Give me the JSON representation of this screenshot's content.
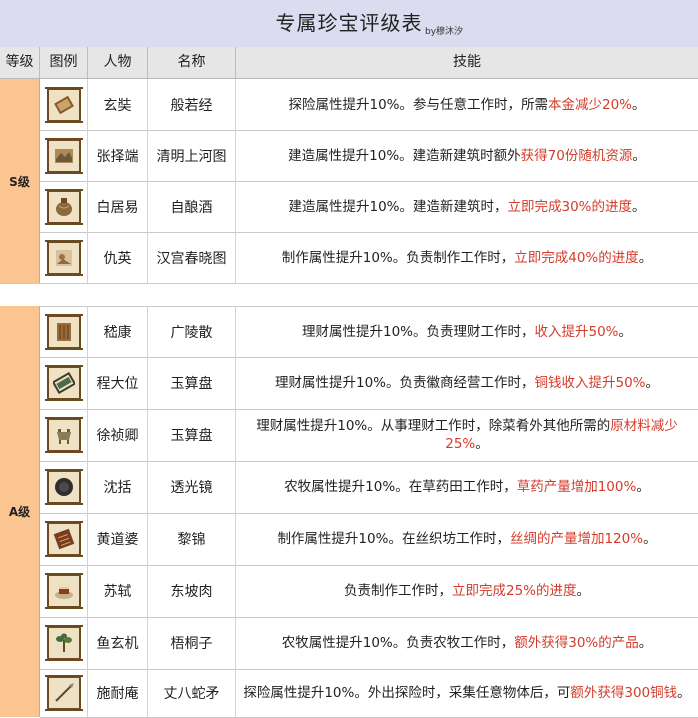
{
  "page": {
    "title": "专属珍宝评级表",
    "byline": "by穆沐汐"
  },
  "header": {
    "grade": "等级",
    "icon": "图例",
    "person": "人物",
    "name": "名称",
    "skill": "技能"
  },
  "sections": [
    {
      "grade": "S级",
      "rows": [
        {
          "icon": "scroll-book-icon",
          "person": "玄奘",
          "name": "般若经",
          "skill_plain": "探险属性提升10%。参与任意工作时，所需",
          "skill_hl": "本金减少20%",
          "skill_end": "。"
        },
        {
          "icon": "painting-scroll-icon",
          "person": "张择端",
          "name": "清明上河图",
          "skill_plain": "建造属性提升10%。建造新建筑时额外",
          "skill_hl": "获得70份随机资源",
          "skill_end": "。"
        },
        {
          "icon": "wine-jar-icon",
          "person": "白居易",
          "name": "自酿酒",
          "skill_plain": "建造属性提升10%。建造新建筑时，",
          "skill_hl": "立即完成30%的进度",
          "skill_end": "。"
        },
        {
          "icon": "spring-painting-icon",
          "person": "仇英",
          "name": "汉宫春晓图",
          "skill_plain": "制作属性提升10%。负责制作工作时，",
          "skill_hl": "立即完成40%的进度",
          "skill_end": "。"
        }
      ]
    },
    {
      "grade": "A级",
      "rows": [
        {
          "icon": "guqin-score-icon",
          "person": "嵇康",
          "name": "广陵散",
          "skill_plain": "理财属性提升10%。负责理财工作时，",
          "skill_hl": "收入提升50%",
          "skill_end": "。"
        },
        {
          "icon": "abacus-icon",
          "person": "程大位",
          "name": "玉算盘",
          "skill_plain": "理财属性提升10%。负责徽商经营工作时，",
          "skill_hl": "铜钱收入提升50%",
          "skill_end": "。"
        },
        {
          "icon": "cauldron-icon",
          "person": "徐祯卿",
          "name": "玉算盘",
          "skill_plain": "理财属性提升10%。从事理财工作时，除菜肴外其他所需的",
          "skill_hl": "原材料减少25%",
          "skill_end": "。"
        },
        {
          "icon": "lens-icon",
          "person": "沈括",
          "name": "透光镜",
          "skill_plain": "农牧属性提升10%。在草药田工作时，",
          "skill_hl": "草药产量增加100%",
          "skill_end": "。"
        },
        {
          "icon": "brocade-icon",
          "person": "黄道婆",
          "name": "黎锦",
          "skill_plain": "制作属性提升10%。在丝织坊工作时，",
          "skill_hl": "丝绸的产量增加120%",
          "skill_end": "。"
        },
        {
          "icon": "meat-dish-icon",
          "person": "苏轼",
          "name": "东坡肉",
          "skill_plain": "负责制作工作时，",
          "skill_hl": "立即完成25%的进度",
          "skill_end": "。"
        },
        {
          "icon": "paulownia-seed-icon",
          "person": "鱼玄机",
          "name": "梧桐子",
          "skill_plain": "农牧属性提升10%。负责农牧工作时，",
          "skill_hl": "额外获得30%的产品",
          "skill_end": "。"
        },
        {
          "icon": "snake-spear-icon",
          "person": "施耐庵",
          "name": "丈八蛇矛",
          "skill_plain": "探险属性提升10%。外出探险时，采集任意物体后，可",
          "skill_hl": "额外获得300铜钱",
          "skill_end": "。"
        }
      ]
    }
  ]
}
